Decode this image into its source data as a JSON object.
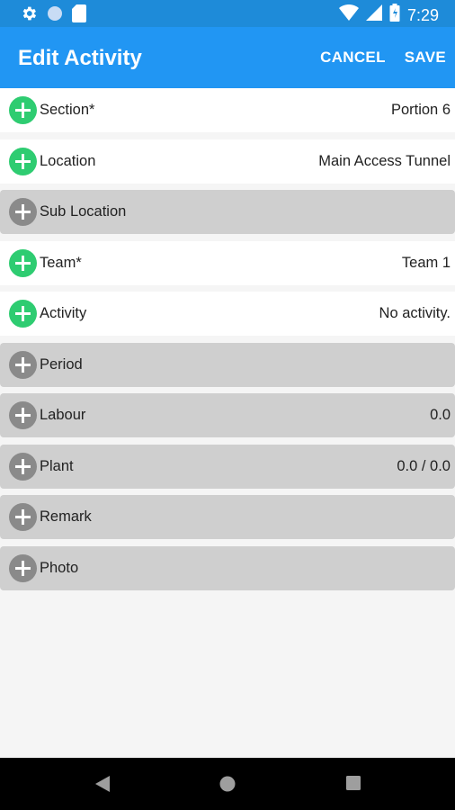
{
  "status": {
    "time": "7:29",
    "icons": [
      "gear-icon",
      "circle-icon",
      "sd-card-icon",
      "wifi-icon",
      "signal-icon",
      "battery-icon"
    ]
  },
  "header": {
    "title": "Edit Activity",
    "cancel_label": "CANCEL",
    "save_label": "SAVE",
    "color": "#2196f3"
  },
  "rows": [
    {
      "label": "Section*",
      "value": "Portion 6",
      "active": true
    },
    {
      "label": "Location",
      "value": "Main Access Tunnel",
      "active": true
    },
    {
      "label": "Sub Location",
      "value": "",
      "active": false
    },
    {
      "label": "Team*",
      "value": "Team 1",
      "active": true
    },
    {
      "label": "Activity",
      "value": "No activity.",
      "active": true
    },
    {
      "label": "Period",
      "value": "",
      "active": false
    },
    {
      "label": "Labour",
      "value": "0.0",
      "active": false
    },
    {
      "label": "Plant",
      "value": "0.0 / 0.0",
      "active": false
    },
    {
      "label": "Remark",
      "value": "",
      "active": false
    },
    {
      "label": "Photo",
      "value": "",
      "active": false
    }
  ],
  "colors": {
    "active_plus": "#2ecc71",
    "inactive_plus": "#8a8a8a",
    "inactive_row": "#cfcfcf"
  },
  "nav": {
    "icons": [
      "back-icon",
      "home-icon",
      "recents-icon"
    ]
  }
}
